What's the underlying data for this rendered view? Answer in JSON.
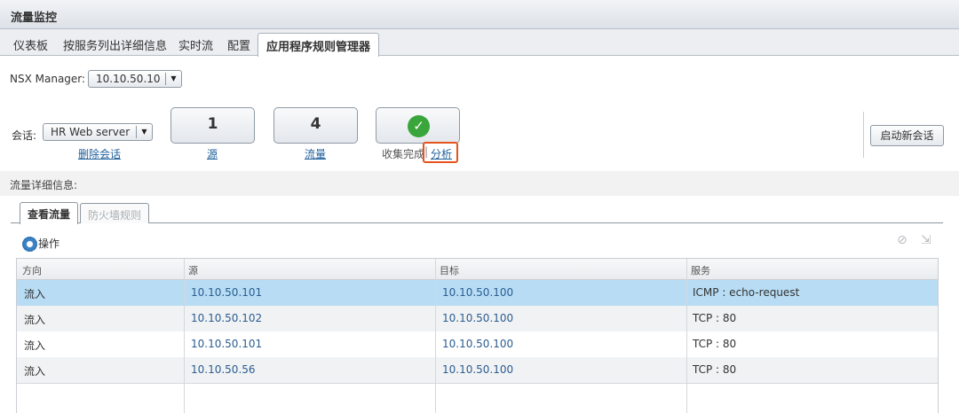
{
  "window": {
    "title": "流量监控"
  },
  "main_tabs": [
    "仪表板",
    "按服务列出详细信息",
    "实时流",
    "配置",
    "应用程序规则管理器"
  ],
  "nsx_manager": {
    "label": "NSX Manager:",
    "value": "10.10.50.10"
  },
  "session": {
    "label": "会话:",
    "value": "HR Web server",
    "delete_link": "删除会话"
  },
  "stats": {
    "sources": {
      "count": "1",
      "link": "源"
    },
    "flows": {
      "count": "4",
      "link": "流量"
    },
    "collection": {
      "status": "收集完成",
      "analyze_link": "分析"
    }
  },
  "new_session_button": "启动新会话",
  "flow_details_label": "流量详细信息:",
  "sub_tabs": [
    "查看流量",
    "防火墙规则"
  ],
  "actions_label": "操作",
  "table": {
    "columns": [
      "方向",
      "源",
      "目标",
      "服务"
    ],
    "rows": [
      {
        "direction": "流入",
        "source": "10.10.50.101",
        "destination": "10.10.50.100",
        "service": "ICMP : echo-request",
        "selected": true
      },
      {
        "direction": "流入",
        "source": "10.10.50.102",
        "destination": "10.10.50.100",
        "service": "TCP : 80",
        "selected": false
      },
      {
        "direction": "流入",
        "source": "10.10.50.101",
        "destination": "10.10.50.100",
        "service": "TCP : 80",
        "selected": false
      },
      {
        "direction": "流入",
        "source": "10.10.50.56",
        "destination": "10.10.50.100",
        "service": "TCP : 80",
        "selected": false
      }
    ]
  },
  "colors": {
    "selected_row": "#b7dcf4",
    "link": "#1f5f9b",
    "highlight_box": "#e4541e",
    "success": "#3aa53a"
  }
}
